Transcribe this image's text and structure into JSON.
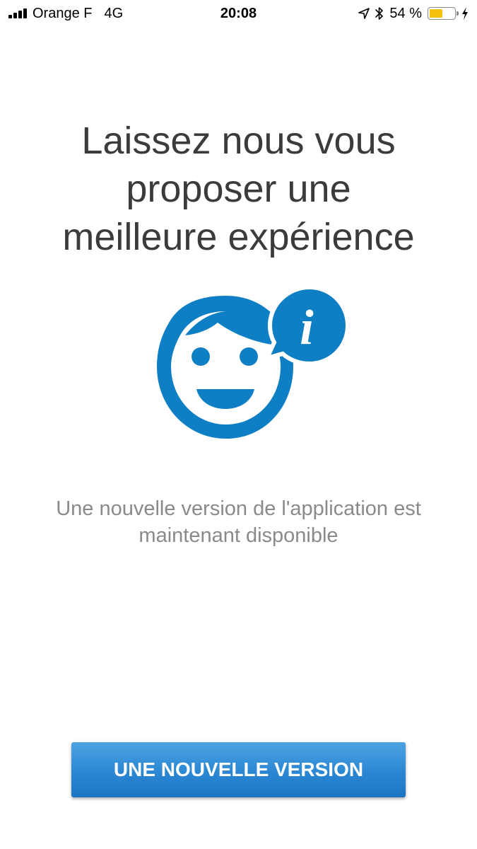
{
  "status_bar": {
    "carrier": "Orange F",
    "network": "4G",
    "time": "20:08",
    "battery_percent": "54 %",
    "battery_level": 0.54,
    "battery_color": "#f4c20d",
    "icons": [
      "signal-icon",
      "location-arrow-icon",
      "bluetooth-icon",
      "battery-icon",
      "charging-bolt-icon"
    ]
  },
  "main": {
    "headline_lines": [
      "Laissez nous vous",
      "proposer une",
      "meilleure expérience"
    ],
    "illustration": {
      "icon": "smiling-face-with-info-bubble-icon",
      "color": "#0e7fc4",
      "bubble_glyph": "i"
    },
    "message_lines": [
      "Une nouvelle version de l'application est",
      "maintenant disponible"
    ]
  },
  "cta": {
    "label": "UNE NOUVELLE VERSION",
    "color": "#2b87d3"
  }
}
